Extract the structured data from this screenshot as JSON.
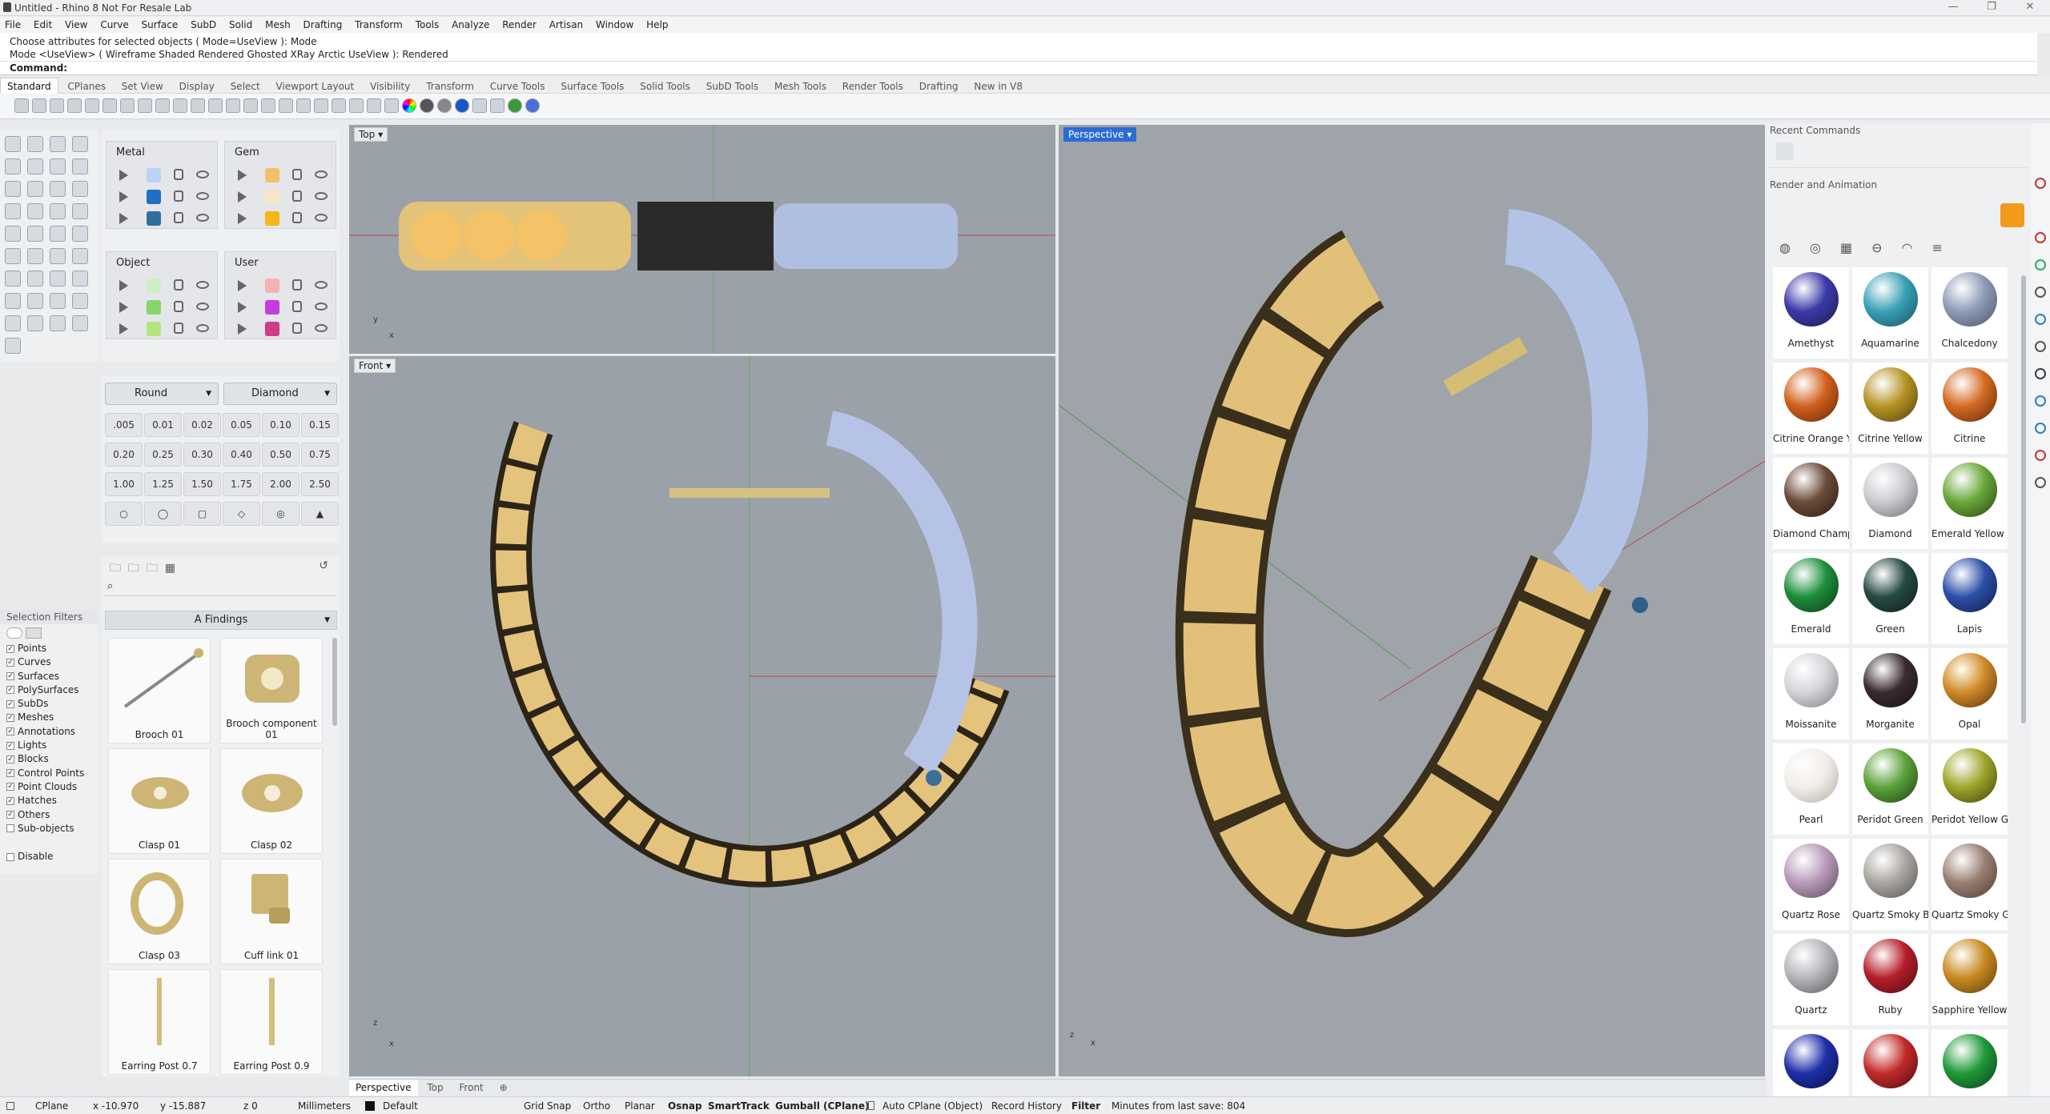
{
  "window": {
    "title": "Untitled - Rhino 8 Not For Resale Lab"
  },
  "menu": [
    "File",
    "Edit",
    "View",
    "Curve",
    "Surface",
    "SubD",
    "Solid",
    "Mesh",
    "Drafting",
    "Transform",
    "Tools",
    "Analyze",
    "Render",
    "Artisan",
    "Window",
    "Help"
  ],
  "command_history": [
    "Choose attributes for selected objects ( Mode=UseView ): Mode",
    "Mode <UseView> ( Wireframe Shaded Rendered Ghosted XRay Arctic UseView ): Rendered"
  ],
  "command_prompt": "Command:",
  "toolbar_tabs": [
    "Standard",
    "CPlanes",
    "Set View",
    "Display",
    "Select",
    "Viewport Layout",
    "Visibility",
    "Transform",
    "Curve Tools",
    "Surface Tools",
    "Solid Tools",
    "SubD Tools",
    "Mesh Tools",
    "Render Tools",
    "Drafting",
    "New in V8"
  ],
  "layers": {
    "metal": {
      "title": "Metal",
      "colors": [
        "#b9d3f4",
        "#1f6fc4",
        "#2f6f9f"
      ]
    },
    "gem": {
      "title": "Gem",
      "colors": [
        "#f3c06a",
        "#f7e7c6",
        "#f5b61a"
      ]
    },
    "object": {
      "title": "Object",
      "colors": [
        "#cdeec3",
        "#86d66a",
        "#b2e67c"
      ]
    },
    "user": {
      "title": "User",
      "colors": [
        "#f4b2b4",
        "#c33de0",
        "#d03a8a"
      ]
    }
  },
  "gems": {
    "cut": "Round",
    "stone": "Diamond",
    "sizes": [
      ".005",
      "0.01",
      "0.02",
      "0.05",
      "0.10",
      "0.15",
      "0.20",
      "0.25",
      "0.30",
      "0.40",
      "0.50",
      "0.75",
      "1.00",
      "1.25",
      "1.50",
      "1.75",
      "2.00",
      "2.50"
    ]
  },
  "selection_filters": {
    "title": "Selection Filters",
    "items": [
      "Points",
      "Curves",
      "Surfaces",
      "PolySurfaces",
      "SubDs",
      "Meshes",
      "Annotations",
      "Lights",
      "Blocks",
      "Control Points",
      "Point Clouds",
      "Hatches",
      "Others",
      "Sub-objects"
    ],
    "checked": [
      true,
      true,
      true,
      true,
      true,
      true,
      true,
      true,
      true,
      true,
      true,
      true,
      true,
      false
    ],
    "disable": "Disable"
  },
  "library": {
    "folder": "A Findings",
    "items": [
      "Brooch 01",
      "Brooch component 01",
      "Clasp 01",
      "Clasp 02",
      "Clasp 03",
      "Cuff link 01",
      "Earring Post 0.7",
      "Earring Post 0.9"
    ]
  },
  "viewports": {
    "top": "Top",
    "front": "Front",
    "perspective": "Perspective"
  },
  "viewport_tabs": [
    "Perspective",
    "Top",
    "Front"
  ],
  "right_panel": {
    "recent": "Recent Commands",
    "render": "Render and Animation",
    "materials": [
      {
        "name": "Amethyst",
        "color": "#3b3aa8"
      },
      {
        "name": "Aquamarine",
        "color": "#3aa0b6"
      },
      {
        "name": "Chalcedony",
        "color": "#8e9bb5"
      },
      {
        "name": "Citrine Orange Y",
        "color": "#d1601c"
      },
      {
        "name": "Citrine Yellow",
        "color": "#b59324"
      },
      {
        "name": "Citrine",
        "color": "#d46a22"
      },
      {
        "name": "Diamond Champ",
        "color": "#6b4b39"
      },
      {
        "name": "Diamond",
        "color": "#c9cbcf"
      },
      {
        "name": "Emerald Yellow C",
        "color": "#6aa83a"
      },
      {
        "name": "Emerald",
        "color": "#1d8f3a"
      },
      {
        "name": "Green",
        "color": "#274a44"
      },
      {
        "name": "Lapis",
        "color": "#2c4fa8"
      },
      {
        "name": "Moissanite",
        "color": "#d4d6da"
      },
      {
        "name": "Morganite",
        "color": "#3a2b2f"
      },
      {
        "name": "Opal",
        "color": "#d08a2a"
      },
      {
        "name": "Pearl",
        "color": "#f1ede9"
      },
      {
        "name": "Peridot Green",
        "color": "#5ca23a"
      },
      {
        "name": "Peridot Yellow G",
        "color": "#9ea52a"
      },
      {
        "name": "Quartz Rose",
        "color": "#b89bb8"
      },
      {
        "name": "Quartz Smoky B",
        "color": "#a9a5a0"
      },
      {
        "name": "Quartz Smoky G",
        "color": "#9a7f72"
      },
      {
        "name": "Quartz",
        "color": "#b4b6ba"
      },
      {
        "name": "Ruby",
        "color": "#b51e2a"
      },
      {
        "name": "Sapphire Yellow",
        "color": "#c98a22"
      }
    ]
  },
  "status": {
    "cplane": "CPlane",
    "x": "x -10.970",
    "y": "y -15.887",
    "z": "z 0",
    "units": "Millimeters",
    "layer": "Default",
    "toggles": [
      "Grid Snap",
      "Ortho",
      "Planar",
      "Osnap",
      "SmartTrack",
      "Gumball (CPlane)",
      "Auto CPlane (Object)",
      "Record History",
      "Filter"
    ],
    "minutes": "Minutes from last save: 804"
  }
}
